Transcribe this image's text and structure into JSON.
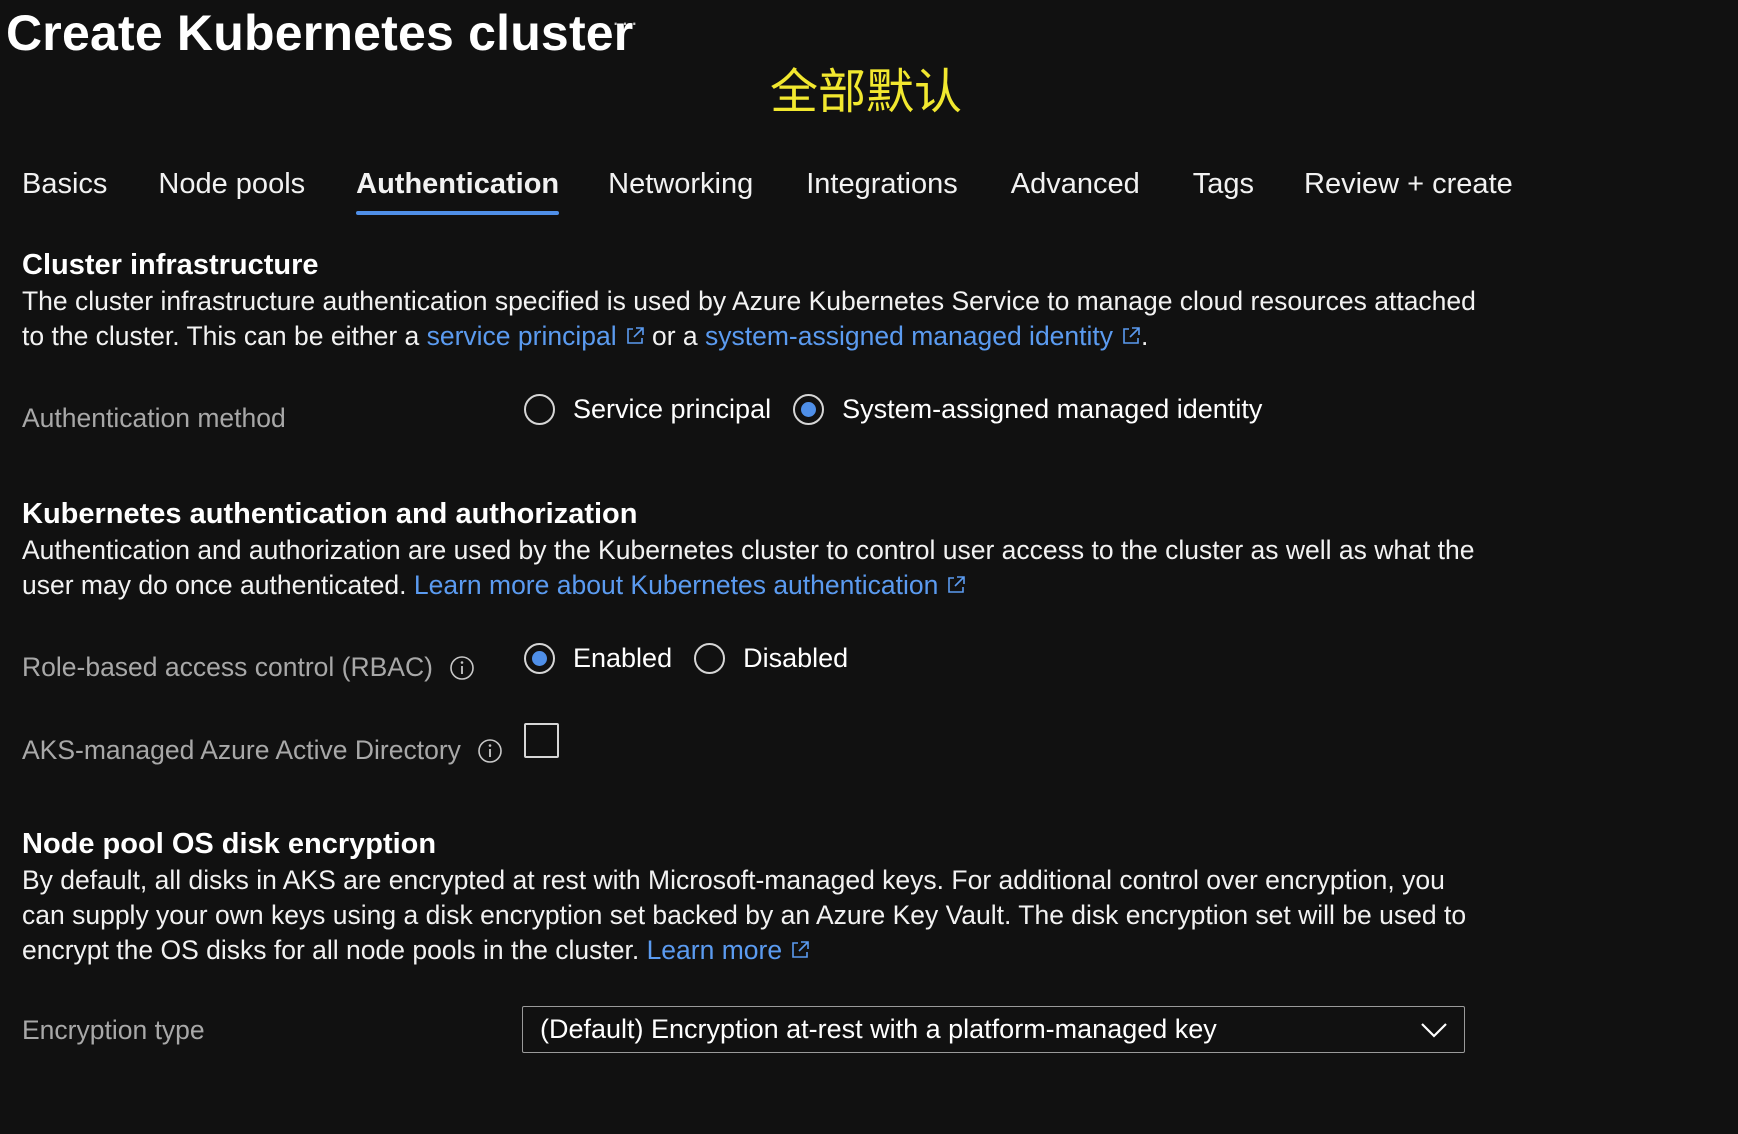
{
  "header": {
    "title": "Create Kubernetes cluster",
    "more_label": "···",
    "annotation": "全部默认"
  },
  "tabs": [
    {
      "label": "Basics",
      "active": false
    },
    {
      "label": "Node pools",
      "active": false
    },
    {
      "label": "Authentication",
      "active": true
    },
    {
      "label": "Networking",
      "active": false
    },
    {
      "label": "Integrations",
      "active": false
    },
    {
      "label": "Advanced",
      "active": false
    },
    {
      "label": "Tags",
      "active": false
    },
    {
      "label": "Review + create",
      "active": false
    }
  ],
  "cluster_infra": {
    "title": "Cluster infrastructure",
    "desc_part1": "The cluster infrastructure authentication specified is used by Azure Kubernetes Service to manage cloud resources attached to the cluster. This can be either a ",
    "link1": "service principal",
    "desc_part2": " or a ",
    "link2": "system-assigned managed identity",
    "desc_part3": ".",
    "auth_method_label": "Authentication method",
    "options": [
      {
        "label": "Service principal",
        "selected": false
      },
      {
        "label": "System-assigned managed identity",
        "selected": true
      }
    ]
  },
  "k8s_auth": {
    "title": "Kubernetes authentication and authorization",
    "desc": "Authentication and authorization are used by the Kubernetes cluster to control user access to the cluster as well as what the user may do once authenticated. ",
    "link": "Learn more about Kubernetes authentication",
    "rbac_label": "Role-based access control (RBAC)",
    "rbac_options": [
      {
        "label": "Enabled",
        "selected": true
      },
      {
        "label": "Disabled",
        "selected": false
      }
    ],
    "aad_label": "AKS-managed Azure Active Directory",
    "aad_checked": false
  },
  "disk_encryption": {
    "title": "Node pool OS disk encryption",
    "desc": "By default, all disks in AKS are encrypted at rest with Microsoft-managed keys. For additional control over encryption, you can supply your own keys using a disk encryption set backed by an Azure Key Vault. The disk encryption set will be used to encrypt the OS disks for all node pools in the cluster. ",
    "link": "Learn more",
    "encryption_type_label": "Encryption type",
    "encryption_type_value": "(Default) Encryption at-rest with a platform-managed key"
  },
  "colors": {
    "background": "#111111",
    "accent": "#4f8fe8",
    "link": "#5b9bf0",
    "annotation": "#f2e82f",
    "label_muted": "#a8a8a8"
  },
  "icons": {
    "external_link": "external-link-icon",
    "info": "info-icon",
    "dropdown": "chevron-down-icon"
  }
}
